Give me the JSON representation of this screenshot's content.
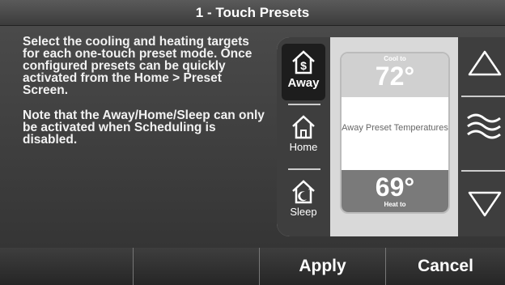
{
  "header": {
    "title": "1 - Touch Presets"
  },
  "instructions": {
    "para1": "Select the cooling and heating targets for each one-touch preset mode. Once configured presets can be quickly activated from the Home > Preset Screen.",
    "para2": "Note that the Away/Home/Sleep can only be activated when Scheduling is disabled."
  },
  "modes": [
    {
      "label": "Away",
      "icon": "dollar-house-icon",
      "selected": true
    },
    {
      "label": "Home",
      "icon": "house-icon",
      "selected": false
    },
    {
      "label": "Sleep",
      "icon": "moon-house-icon",
      "selected": false
    }
  ],
  "card": {
    "cool_label": "Cool to",
    "cool_value": "72°",
    "middle_text": "Away Preset Temperatures",
    "heat_label": "Heat to",
    "heat_value": "69°"
  },
  "controls": {
    "up": "up-arrow-icon",
    "fan": "wave-icon",
    "down": "down-arrow-icon"
  },
  "footer": {
    "btn1": "",
    "btn2": "",
    "apply": "Apply",
    "cancel": "Cancel"
  },
  "colors": {
    "background": "#3a3a3a",
    "panel": "#d9d9d9",
    "cool": "#d0d0d0",
    "heat": "#7a7a7a"
  }
}
